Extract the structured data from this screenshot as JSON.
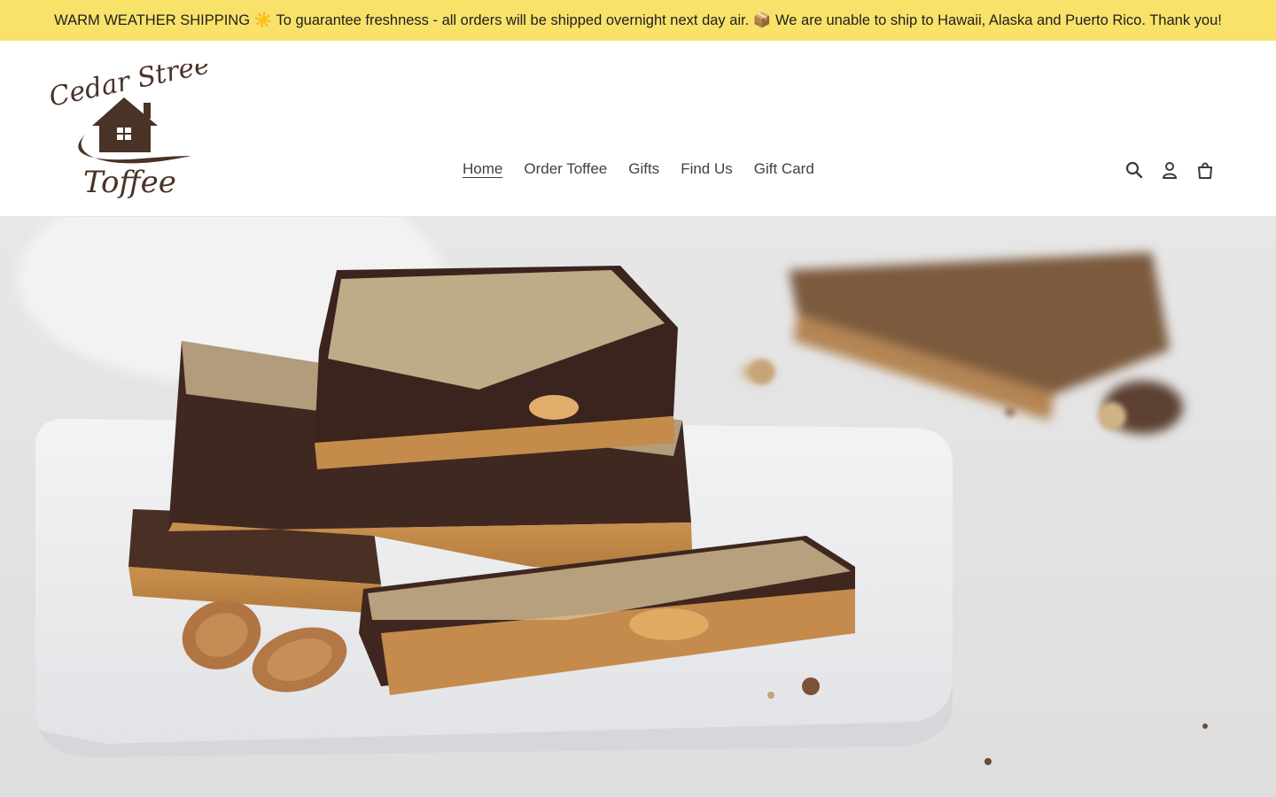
{
  "announcement": {
    "text": "WARM WEATHER SHIPPING ☀️ To guarantee freshness - all orders will be shipped overnight next day air. 📦 We are unable to ship to Hawaii, Alaska and Puerto Rico. Thank you!"
  },
  "header": {
    "logo": {
      "line1": "Cedar Street",
      "line2": "Toffee",
      "color": "#4a3226"
    },
    "nav": {
      "items": [
        {
          "label": "Home",
          "active": true
        },
        {
          "label": "Order Toffee",
          "active": false
        },
        {
          "label": "Gifts",
          "active": false
        },
        {
          "label": "Find Us",
          "active": false
        },
        {
          "label": "Gift Card",
          "active": false
        }
      ]
    },
    "icons": [
      "search-icon",
      "account-icon",
      "cart-icon"
    ]
  },
  "hero": {
    "image": "toffee-on-white-plate"
  },
  "colors": {
    "announcement_bg": "#f8e26a",
    "brand_brown": "#4a3226",
    "nav_text": "#3d4246"
  }
}
